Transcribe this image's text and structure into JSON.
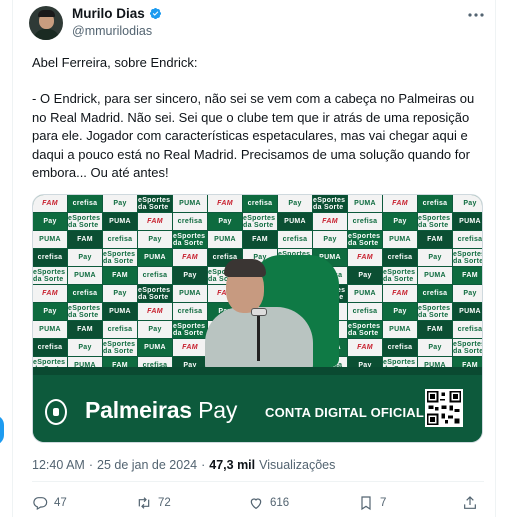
{
  "author": {
    "display_name": "Murilo Dias",
    "handle": "@mmurilodias",
    "verified": true
  },
  "tweet": {
    "paragraphs": [
      "Abel Ferreira, sobre Endrick:",
      "- O Endrick, para ser sincero, não sei se vem com a cabeça no Palmeiras ou no Real Madrid. Não sei. Sei que o clube tem que ir atrás de uma reposição para ele. Jogador com características espetaculares, mas vai chegar aqui e daqui a pouco está no Real Madrid. Precisamos de uma solução quando for embora... Ou até antes!"
    ]
  },
  "media": {
    "sponsor_brand_bold": "Palmeiras",
    "sponsor_brand_light": "Pay",
    "sponsor_slogan": "CONTA DIGITAL OFICIAL",
    "backdrop_logos": [
      "FAM",
      "crefisa",
      "Pay",
      "eSportes da Sorte",
      "PUMA"
    ]
  },
  "meta": {
    "time": "12:40 AM",
    "separator": "·",
    "date": "25 de jan de 2024",
    "views_count": "47,3 mil",
    "views_label": "Visualizações"
  },
  "actions": {
    "replies": "47",
    "reposts": "72",
    "likes": "616",
    "bookmarks": "7"
  },
  "colors": {
    "text_primary": "#0f1419",
    "text_secondary": "#536471",
    "verified_blue": "#1d9bf0",
    "palmeiras_green": "#0e6b3f"
  },
  "icons": [
    "verified-badge-icon",
    "more-options-icon",
    "reply-icon",
    "repost-icon",
    "like-icon",
    "bookmark-icon",
    "share-icon",
    "palmeiras-crest-icon",
    "qr-code-icon"
  ]
}
